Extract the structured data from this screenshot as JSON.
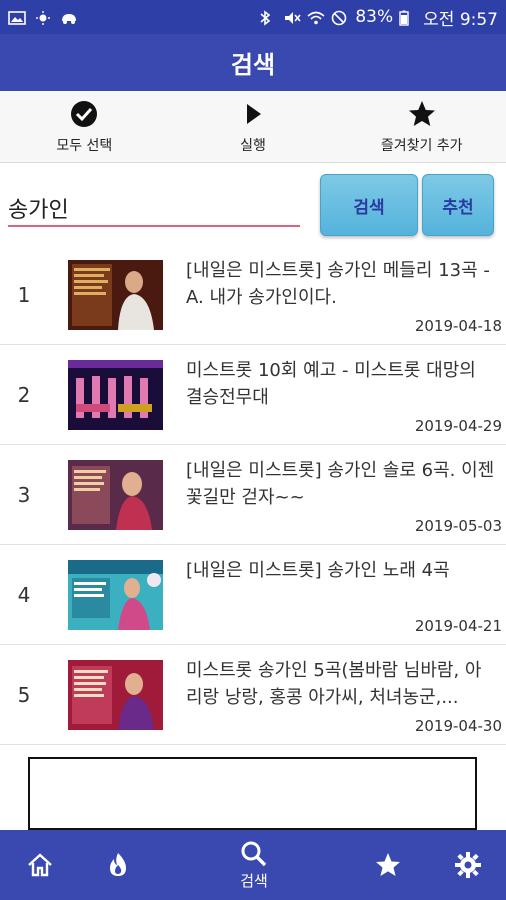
{
  "status_bar": {
    "battery": "83%",
    "time": "오전 9:57"
  },
  "app_bar": {
    "title": "검색"
  },
  "toolbar": {
    "select_all": "모두 선택",
    "run": "실행",
    "add_favorite": "즐겨찾기 추가"
  },
  "search": {
    "query": "송가인",
    "search_button": "검색",
    "recommend_button": "추천"
  },
  "results": [
    {
      "rank": "1",
      "title": "[내일은 미스트롯] 송가인 메들리 13곡 - A. 내가 송가인이다.",
      "date": "2019-04-18"
    },
    {
      "rank": "2",
      "title": "미스트롯 10회 예고 - 미스트롯 대망의 결승전무대",
      "date": "2019-04-29"
    },
    {
      "rank": "3",
      "title": "[내일은 미스트롯] 송가인 솔로 6곡. 이젠 꽃길만 걷자~~",
      "date": "2019-05-03"
    },
    {
      "rank": "4",
      "title": "[내일은 미스트롯] 송가인 노래 4곡",
      "date": "2019-04-21"
    },
    {
      "rank": "5",
      "title": "미스트롯 송가인 5곡(봄바람 님바람, 아리랑 낭랑, 홍콩 아가씨, 처녀농군,...",
      "date": "2019-04-30"
    }
  ],
  "bottom_nav": {
    "search_label": "검색"
  },
  "colors": {
    "primary": "#3949b0",
    "status_bar": "#2f3fa8",
    "button": "#6cc0e2",
    "input_underline": "#e0607e"
  }
}
